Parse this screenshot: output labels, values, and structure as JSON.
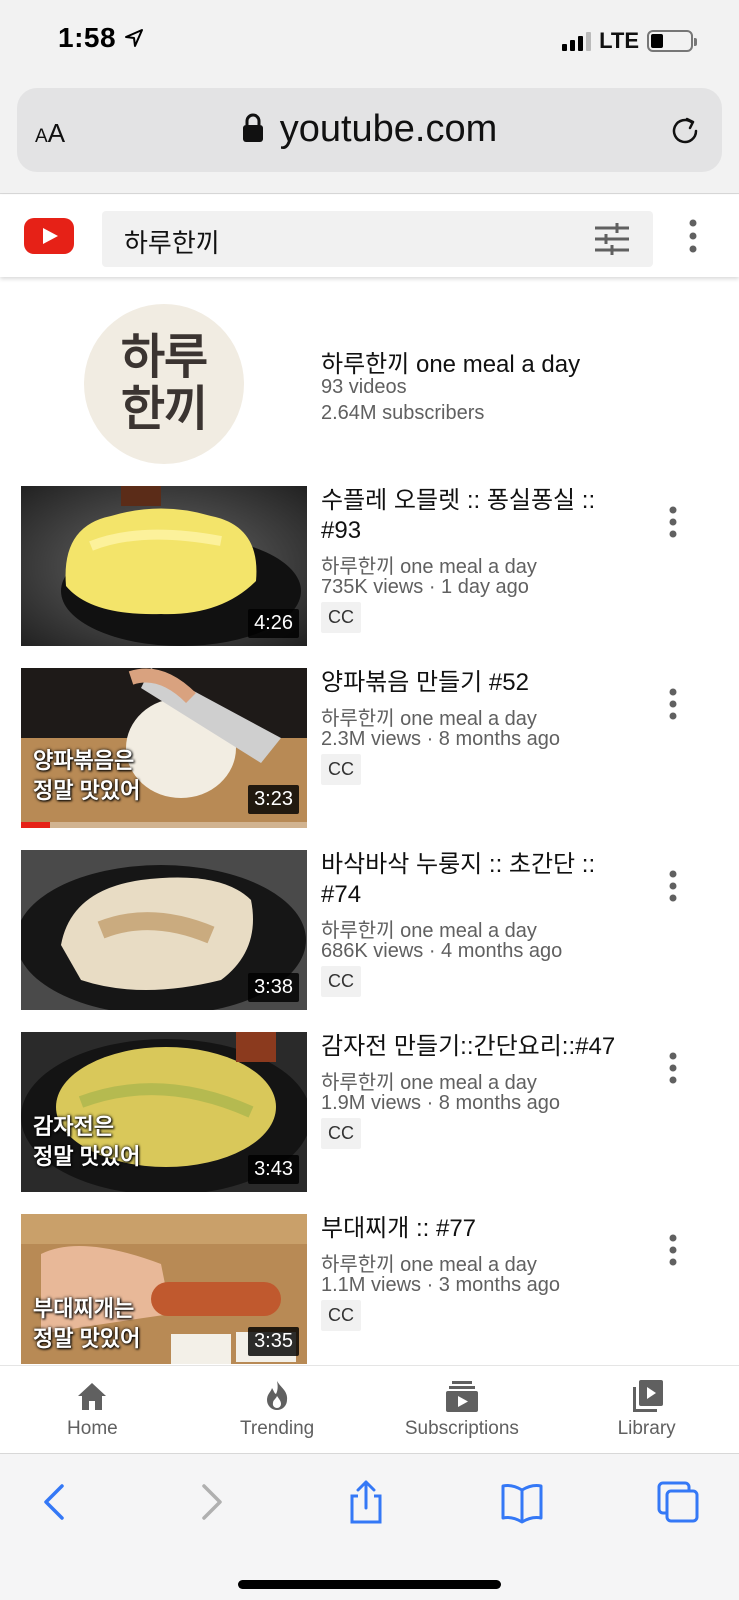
{
  "status": {
    "time": "1:58",
    "network": "LTE"
  },
  "browser": {
    "text_size_label": "AA",
    "url": "youtube.com"
  },
  "search": {
    "query": "하루한끼"
  },
  "channel": {
    "avatar_line1": "하루",
    "avatar_line2": "한끼",
    "name": "하루한끼 one meal a day",
    "videos": "93 videos",
    "subscribers": "2.64M subscribers"
  },
  "videos": [
    {
      "title": "수플레 오믈렛 :: 퐁실퐁실 :: #93",
      "channel": "하루한끼 one meal a day",
      "stats": "735K views · 1 day ago",
      "badge": "CC",
      "duration": "4:26",
      "overlay": ""
    },
    {
      "title": "양파볶음 만들기 #52",
      "channel": "하루한끼 one meal a day",
      "stats": "2.3M views · 8 months ago",
      "badge": "CC",
      "duration": "3:23",
      "overlay_line1": "양파볶음은",
      "overlay_line2": "정말 맛있어",
      "progress": 0.1
    },
    {
      "title": "바삭바삭 누룽지 :: 초간단 :: #74",
      "channel": "하루한끼 one meal a day",
      "stats": "686K views · 4 months ago",
      "badge": "CC",
      "duration": "3:38"
    },
    {
      "title": "감자전 만들기::간단요리::#47",
      "channel": "하루한끼 one meal a day",
      "stats": "1.9M views · 8 months ago",
      "badge": "CC",
      "duration": "3:43",
      "overlay_line1": "감자전은",
      "overlay_line2": "정말 맛있어"
    },
    {
      "title": "부대찌개 :: #77",
      "channel": "하루한끼 one meal a day",
      "stats": "1.1M views · 3 months ago",
      "badge": "CC",
      "duration": "3:35",
      "overlay_line1": "부대찌개는",
      "overlay_line2": "정말 맛있어"
    }
  ],
  "nav": {
    "home": "Home",
    "trending": "Trending",
    "subscriptions": "Subscriptions",
    "library": "Library"
  },
  "colors": {
    "youtube_red": "#e62117",
    "safari_blue": "#3478f6"
  },
  "icons": [
    "location-arrow-icon",
    "lock-icon",
    "reload-icon",
    "youtube-logo-icon",
    "filter-icon",
    "more-vert-icon",
    "home-icon",
    "trending-icon",
    "subscriptions-icon",
    "library-icon",
    "back-icon",
    "forward-icon",
    "share-icon",
    "bookmarks-icon",
    "tabs-icon"
  ]
}
